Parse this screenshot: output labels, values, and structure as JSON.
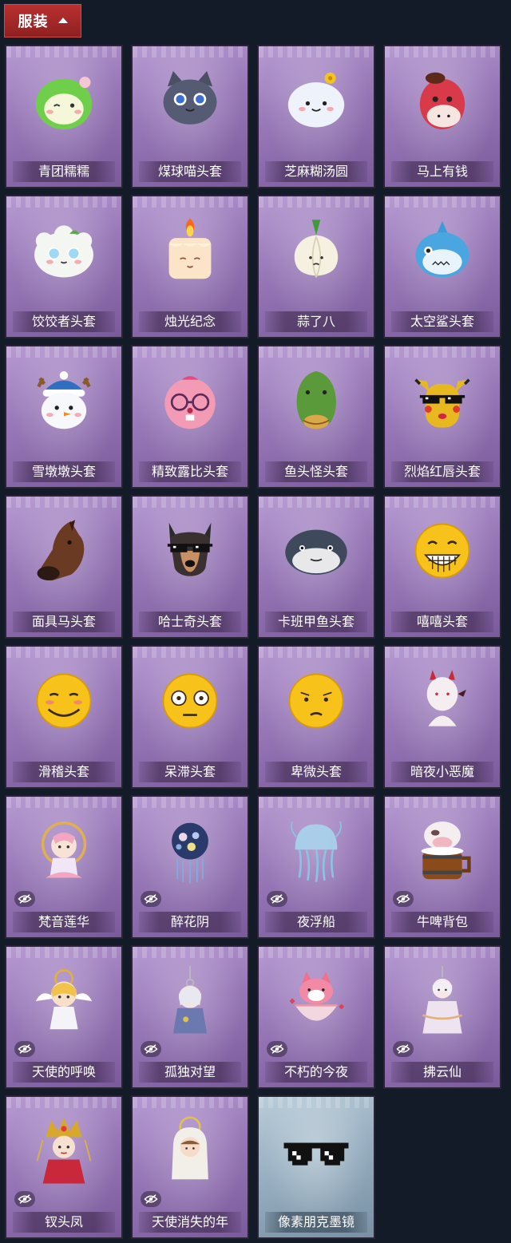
{
  "header": {
    "title": "服装"
  },
  "items": [
    {
      "name": "青团糯糯",
      "icon": "green-rice-ball-head",
      "tone": "purple",
      "hidden": false
    },
    {
      "name": "煤球喵头套",
      "icon": "gray-cat-head",
      "tone": "purple",
      "hidden": false
    },
    {
      "name": "芝麻糊汤圆",
      "icon": "white-dumpling-flower-head",
      "tone": "purple",
      "hidden": false
    },
    {
      "name": "马上有钱",
      "icon": "red-horse-head",
      "tone": "purple",
      "hidden": false
    },
    {
      "name": "饺饺者头套",
      "icon": "white-dumpling-head",
      "tone": "purple",
      "hidden": false
    },
    {
      "name": "烛光纪念",
      "icon": "candle-head",
      "tone": "purple",
      "hidden": false
    },
    {
      "name": "蒜了八",
      "icon": "garlic-head",
      "tone": "purple",
      "hidden": false
    },
    {
      "name": "太空鲨头套",
      "icon": "blue-shark-head",
      "tone": "purple",
      "hidden": false
    },
    {
      "name": "雪墩墩头套",
      "icon": "snowman-reindeer-head",
      "tone": "purple",
      "hidden": false
    },
    {
      "name": "精致露比头套",
      "icon": "pink-beaver-glasses-head",
      "tone": "purple",
      "hidden": false
    },
    {
      "name": "鱼头怪头套",
      "icon": "green-fish-head",
      "tone": "purple",
      "hidden": false
    },
    {
      "name": "烈焰红唇头套",
      "icon": "yellow-pikachu-sunglasses-head",
      "tone": "purple",
      "hidden": false
    },
    {
      "name": "面具马头套",
      "icon": "brown-horse-mask",
      "tone": "purple",
      "hidden": false
    },
    {
      "name": "哈士奇头套",
      "icon": "husky-sunglasses-head",
      "tone": "purple",
      "hidden": false
    },
    {
      "name": "卡班甲鱼头套",
      "icon": "round-fish-head",
      "tone": "purple",
      "hidden": false
    },
    {
      "name": "嘻嘻头套",
      "icon": "grinning-emoji-head",
      "tone": "purple",
      "hidden": false
    },
    {
      "name": "滑稽头套",
      "icon": "smirk-emoji-head",
      "tone": "purple",
      "hidden": false
    },
    {
      "name": "呆滞头套",
      "icon": "dazed-emoji-head",
      "tone": "purple",
      "hidden": false
    },
    {
      "name": "卑微头套",
      "icon": "humble-emoji-head",
      "tone": "purple",
      "hidden": false
    },
    {
      "name": "暗夜小恶魔",
      "icon": "little-devil-head",
      "tone": "purple",
      "hidden": false
    },
    {
      "name": "梵音莲华",
      "icon": "lotus-doll-backpack",
      "tone": "purple",
      "hidden": true
    },
    {
      "name": "醉花阴",
      "icon": "flower-lantern-backpack",
      "tone": "purple",
      "hidden": true
    },
    {
      "name": "夜浮船",
      "icon": "jellyfish-backpack",
      "tone": "purple",
      "hidden": true
    },
    {
      "name": "牛啤背包",
      "icon": "cow-beer-barrel-backpack",
      "tone": "purple",
      "hidden": true
    },
    {
      "name": "天使的呼唤",
      "icon": "angel-doll-backpack",
      "tone": "purple",
      "hidden": true
    },
    {
      "name": "孤独对望",
      "icon": "hanging-doll-backpack",
      "tone": "purple",
      "hidden": true
    },
    {
      "name": "不朽的今夜",
      "icon": "pink-fox-bowl-backpack",
      "tone": "purple",
      "hidden": true
    },
    {
      "name": "拂云仙",
      "icon": "cloud-fairy-backpack",
      "tone": "purple",
      "hidden": true
    },
    {
      "name": "钗头凤",
      "icon": "phoenix-crown-backpack",
      "tone": "purple",
      "hidden": true
    },
    {
      "name": "天使消失的年",
      "icon": "hooded-angel-backpack",
      "tone": "purple",
      "hidden": true
    },
    {
      "name": "像素朋克墨镜",
      "icon": "pixel-sunglasses",
      "tone": "blue",
      "hidden": false
    }
  ]
}
